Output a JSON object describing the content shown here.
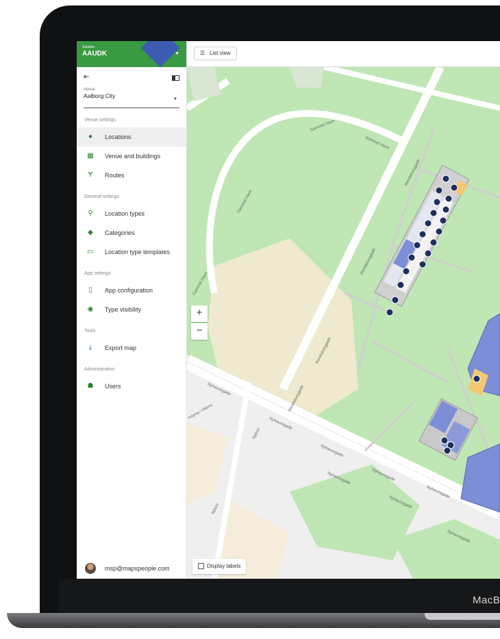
{
  "device": {
    "brand_text": "MacB"
  },
  "sidebar": {
    "solution_label": "Solution",
    "solution_name": "AAUDK",
    "collapse_icon": "collapse-left-icon",
    "panel_icon": "panel-icon",
    "venue": {
      "label": "Venue",
      "value": "Aalborg City"
    },
    "sections": [
      {
        "title": "Venue settings",
        "items": [
          {
            "label": "Locations",
            "icon": "map-marker-icon",
            "active": true
          },
          {
            "label": "Venue and buildings",
            "icon": "building-icon"
          },
          {
            "label": "Routes",
            "icon": "routes-icon"
          }
        ]
      },
      {
        "title": "General settings",
        "items": [
          {
            "label": "Location types",
            "icon": "pin-icon"
          },
          {
            "label": "Categories",
            "icon": "tag-icon"
          },
          {
            "label": "Location type templates",
            "icon": "template-icon"
          }
        ]
      },
      {
        "title": "App settings",
        "items": [
          {
            "label": "App configuration",
            "icon": "app-config-icon"
          },
          {
            "label": "Type visibility",
            "icon": "eye-icon"
          }
        ]
      },
      {
        "title": "Tools",
        "items": [
          {
            "label": "Export map",
            "icon": "download-icon"
          }
        ]
      },
      {
        "title": "Administration",
        "items": [
          {
            "label": "Users",
            "icon": "users-icon"
          }
        ]
      }
    ],
    "user_email": "msp@mapspeople.com"
  },
  "toolbar": {
    "list_view_label": "List view"
  },
  "map": {
    "zoom_in": "+",
    "zoom_out": "−",
    "display_labels": "Display labels",
    "street_labels": [
      "Gammel Havn",
      "Gammel Havn",
      "Gammel Havn",
      "Gammel Havn",
      "Rendsburggade",
      "Rendsburggade",
      "Rendsburggade",
      "Rendsburggade",
      "Nyhavnsgade",
      "Nyhavnsgade",
      "Nyhavnsgade",
      "Nyhavnsgade",
      "Nyhavnsgade",
      "Nyhavnsgade",
      "Nyhavnsgade",
      "Nyhavnsgade",
      "Nytorv",
      "Nytorv",
      "Indgang / Udgang"
    ]
  },
  "colors": {
    "accent_green": "#3a9a43",
    "brand_blue": "#3d5bb0",
    "map_green": "#bfe6b4",
    "poi_dark": "#1f2f5c"
  }
}
